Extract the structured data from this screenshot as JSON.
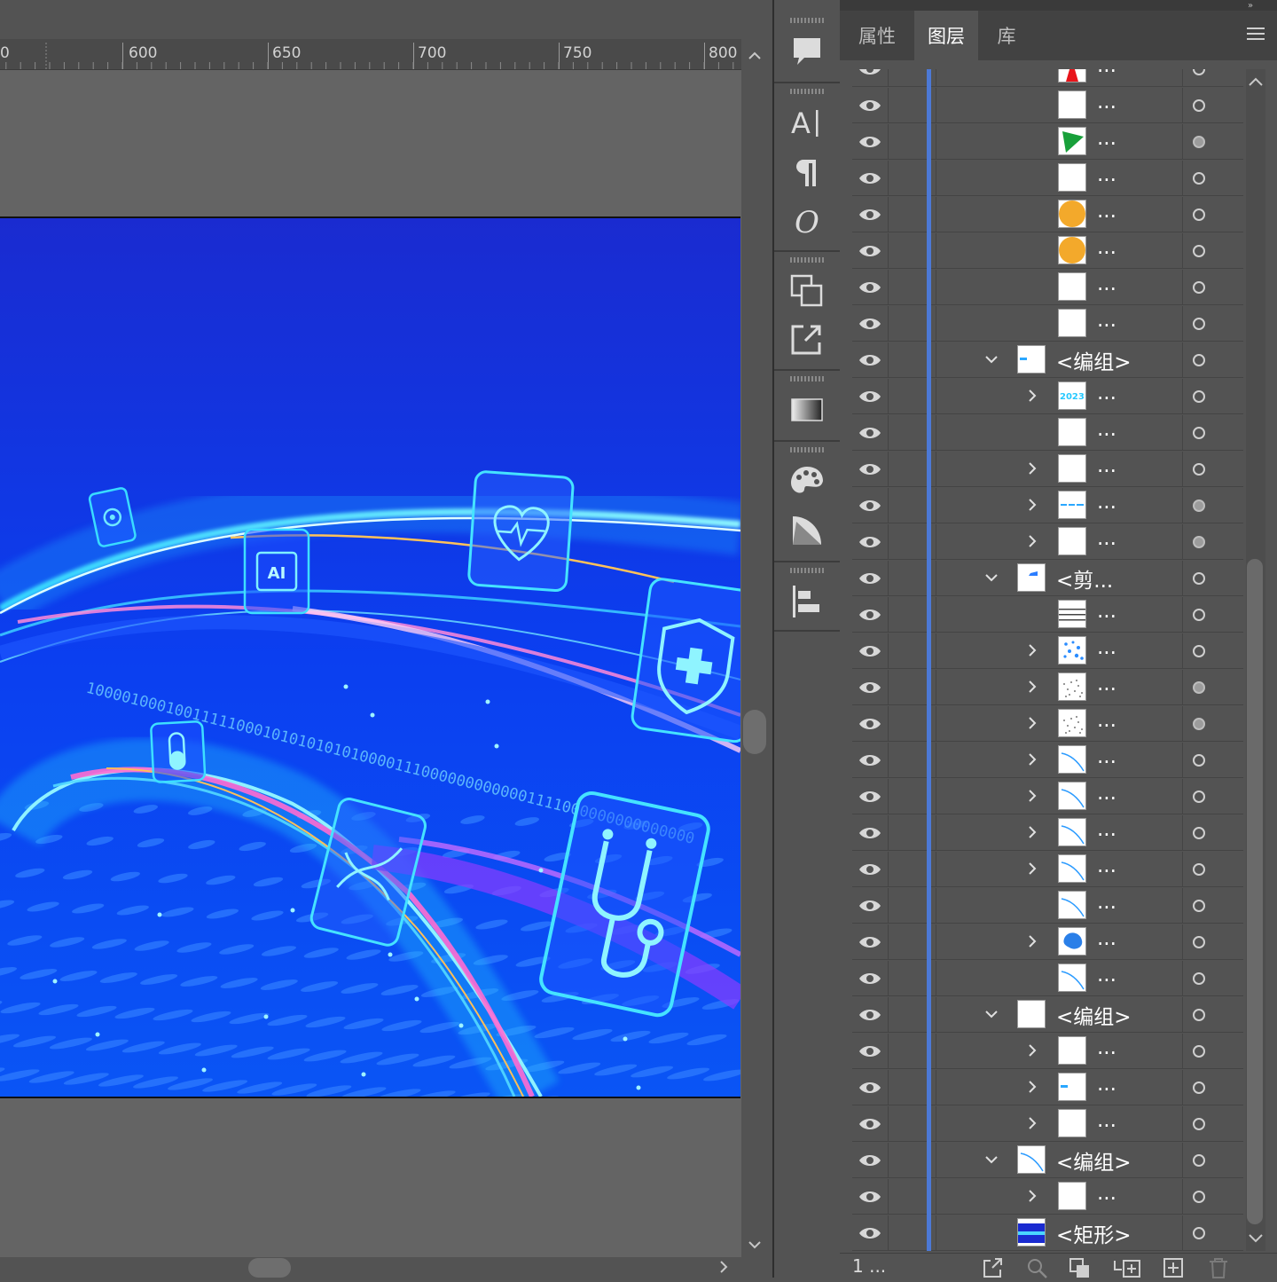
{
  "ruler": {
    "labels": [
      "0",
      "600",
      "650",
      "700",
      "750",
      "800"
    ]
  },
  "panel": {
    "tabs": [
      "属性",
      "图层",
      "库"
    ],
    "active_tab": "图层",
    "footer_count": "1 ..."
  },
  "layers": {
    "rows": [
      {
        "name": "...",
        "chevron": "none",
        "thumb": "red-triangle",
        "indent": 2,
        "target_filled": false
      },
      {
        "name": "...",
        "chevron": "none",
        "thumb": "white",
        "indent": 2,
        "target_filled": false
      },
      {
        "name": "...",
        "chevron": "none",
        "thumb": "green-triangle",
        "indent": 2,
        "target_filled": true
      },
      {
        "name": "...",
        "chevron": "none",
        "thumb": "white",
        "indent": 2,
        "target_filled": false
      },
      {
        "name": "...",
        "chevron": "none",
        "thumb": "orange-circle",
        "indent": 2,
        "target_filled": false
      },
      {
        "name": "...",
        "chevron": "none",
        "thumb": "orange-circle",
        "indent": 2,
        "target_filled": false
      },
      {
        "name": "...",
        "chevron": "none",
        "thumb": "white",
        "indent": 2,
        "target_filled": false
      },
      {
        "name": "...",
        "chevron": "none",
        "thumb": "white",
        "indent": 2,
        "target_filled": false
      },
      {
        "name": "<编组>",
        "chevron": "down",
        "thumb": "small-blue",
        "indent": 1,
        "target_filled": false
      },
      {
        "name": "...",
        "chevron": "right",
        "thumb": "2023",
        "indent": 2,
        "target_filled": false
      },
      {
        "name": "...",
        "chevron": "none",
        "thumb": "white",
        "indent": 2,
        "target_filled": false
      },
      {
        "name": "...",
        "chevron": "right",
        "thumb": "white",
        "indent": 2,
        "target_filled": false
      },
      {
        "name": "...",
        "chevron": "right",
        "thumb": "dashes",
        "indent": 2,
        "target_filled": true
      },
      {
        "name": "...",
        "chevron": "right",
        "thumb": "white",
        "indent": 2,
        "target_filled": true
      },
      {
        "name": "<剪...",
        "chevron": "down",
        "thumb": "blue-mark",
        "indent": 1,
        "target_filled": false
      },
      {
        "name": "...",
        "chevron": "none",
        "thumb": "lines",
        "indent": 2,
        "target_filled": false
      },
      {
        "name": "...",
        "chevron": "right",
        "thumb": "dots",
        "indent": 2,
        "target_filled": false
      },
      {
        "name": "...",
        "chevron": "right",
        "thumb": "noise",
        "indent": 2,
        "target_filled": true
      },
      {
        "name": "...",
        "chevron": "right",
        "thumb": "noise",
        "indent": 2,
        "target_filled": true
      },
      {
        "name": "...",
        "chevron": "right",
        "thumb": "curve",
        "indent": 2,
        "target_filled": false
      },
      {
        "name": "...",
        "chevron": "right",
        "thumb": "curve",
        "indent": 2,
        "target_filled": false
      },
      {
        "name": "...",
        "chevron": "right",
        "thumb": "curve",
        "indent": 2,
        "target_filled": false
      },
      {
        "name": "...",
        "chevron": "right",
        "thumb": "curve",
        "indent": 2,
        "target_filled": false
      },
      {
        "name": "...",
        "chevron": "none",
        "thumb": "curve",
        "indent": 2,
        "target_filled": false
      },
      {
        "name": "...",
        "chevron": "right",
        "thumb": "blob",
        "indent": 2,
        "target_filled": false
      },
      {
        "name": "...",
        "chevron": "none",
        "thumb": "curve",
        "indent": 2,
        "target_filled": false
      },
      {
        "name": "<编组>",
        "chevron": "down",
        "thumb": "white",
        "indent": 1,
        "target_filled": false
      },
      {
        "name": "...",
        "chevron": "right",
        "thumb": "white",
        "indent": 2,
        "target_filled": false
      },
      {
        "name": "...",
        "chevron": "right",
        "thumb": "small-blue",
        "indent": 2,
        "target_filled": false
      },
      {
        "name": "...",
        "chevron": "right",
        "thumb": "white",
        "indent": 2,
        "target_filled": false
      },
      {
        "name": "<编组>",
        "chevron": "down",
        "thumb": "curve",
        "indent": 1,
        "target_filled": false
      },
      {
        "name": "...",
        "chevron": "right",
        "thumb": "white",
        "indent": 2,
        "target_filled": false
      },
      {
        "name": "<矩形>",
        "chevron": "none",
        "thumb": "blue-rect",
        "indent": 1,
        "target_filled": false
      }
    ]
  },
  "artwork": {
    "icons": [
      "gear-card",
      "ai-chip-card",
      "heart-card",
      "shield-card",
      "pill-card",
      "dna-card",
      "stethoscope-card"
    ],
    "binary_text": "100001000100111110001010101010100001110000000000001111000000000000000",
    "chip_label": "AI",
    "thumb_year": "2023"
  },
  "tools": [
    "comment-icon",
    "character-icon",
    "paragraph-icon",
    "opentype-icon",
    "transform-icon",
    "export-icon",
    "gradient-icon",
    "color-icon",
    "transparency-icon",
    "align-icon"
  ]
}
